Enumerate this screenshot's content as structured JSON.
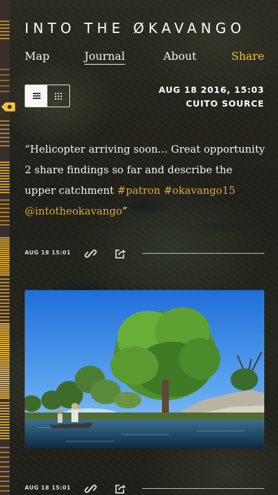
{
  "header": {
    "title": "INTO THE ØKAVANGO"
  },
  "nav": [
    {
      "label": "Map"
    },
    {
      "label": "Journal"
    },
    {
      "label": "About"
    },
    {
      "label": "Share"
    }
  ],
  "colors": {
    "accent": "#f0c23c",
    "hashtag": "#e2a73b",
    "timeline": "#3a2e2a"
  },
  "view_toggle": {
    "active": "list-view",
    "options": [
      "list-icon",
      "grid-icon"
    ]
  },
  "post": {
    "date": "AUG 18 2016, 15:03",
    "location": "CUITO SOURCE",
    "open_quote": "“",
    "text": "Helicopter arriving soon... Great opportunity 2 share findings so far and describe the upper catchment ",
    "tag1": "#patron",
    "tag2": "#okavango15",
    "tag3": "@intotheokavango",
    "close_quote": "”"
  },
  "entries": [
    {
      "time": "AUG 18 15:01",
      "icons": [
        "link-icon",
        "share-icon"
      ]
    },
    {
      "time": "AUG 18 15:01",
      "icons": [
        "link-icon",
        "share-icon"
      ]
    }
  ]
}
